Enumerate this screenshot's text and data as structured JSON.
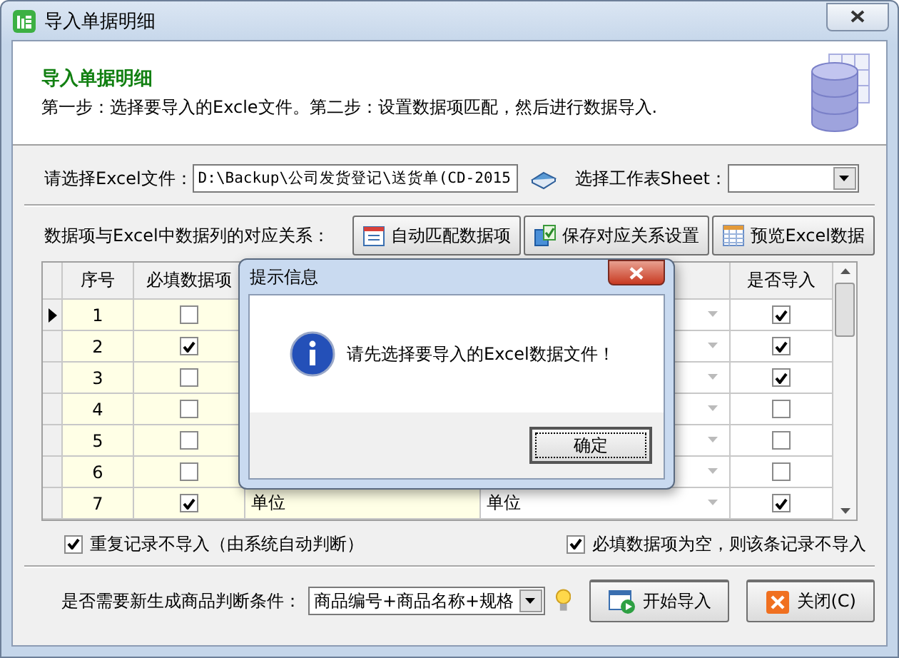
{
  "window": {
    "title": "导入单据明细"
  },
  "header": {
    "title": "导入单据明细",
    "description": "第一步：选择要导入的Excle文件。第二步：设置数据项匹配，然后进行数据导入."
  },
  "file_row": {
    "label": "请选择Excel文件：",
    "value": "D:\\Backup\\公司发货登记\\送货单(CD-2015",
    "sheet_label": "选择工作表Sheet："
  },
  "mapping": {
    "label": "数据项与Excel中数据列的对应关系：",
    "buttons": [
      {
        "label": "自动匹配数据项",
        "kind": "calendar"
      },
      {
        "label": "保存对应关系设置",
        "kind": "save"
      },
      {
        "label": "预览Excel数据",
        "kind": "preview"
      }
    ]
  },
  "grid": {
    "headers": {
      "number": "序号",
      "required": "必填数据项",
      "import": "是否导入"
    },
    "rows": [
      {
        "number": "1",
        "selected": true,
        "required": false,
        "import": true
      },
      {
        "number": "2",
        "selected": false,
        "required": true,
        "import": true
      },
      {
        "number": "3",
        "selected": false,
        "required": false,
        "import": true
      },
      {
        "number": "4",
        "selected": false,
        "required": false,
        "import": false
      },
      {
        "number": "5",
        "selected": false,
        "required": false,
        "import": false
      },
      {
        "number": "6",
        "selected": false,
        "required": false,
        "import": false
      },
      {
        "number": "7",
        "selected": false,
        "required": true,
        "column_3": "单位",
        "column_4": "单位",
        "import": true
      }
    ]
  },
  "options": [
    {
      "label": "重复记录不导入（由系统自动判断）",
      "checked": true
    },
    {
      "label": "必填数据项为空，则该条记录不导入",
      "checked": true
    }
  ],
  "bottom": {
    "condition_label": "是否需要新生成商品判断条件：",
    "condition_value": "商品编号+商品名称+规格",
    "buttons": [
      {
        "label": "开始导入",
        "kind": "start"
      },
      {
        "label": "关闭(C)",
        "kind": "close"
      }
    ]
  },
  "dialog": {
    "title": "提示信息",
    "message": "请先选择要导入的Excel数据文件！",
    "button": "确定"
  }
}
